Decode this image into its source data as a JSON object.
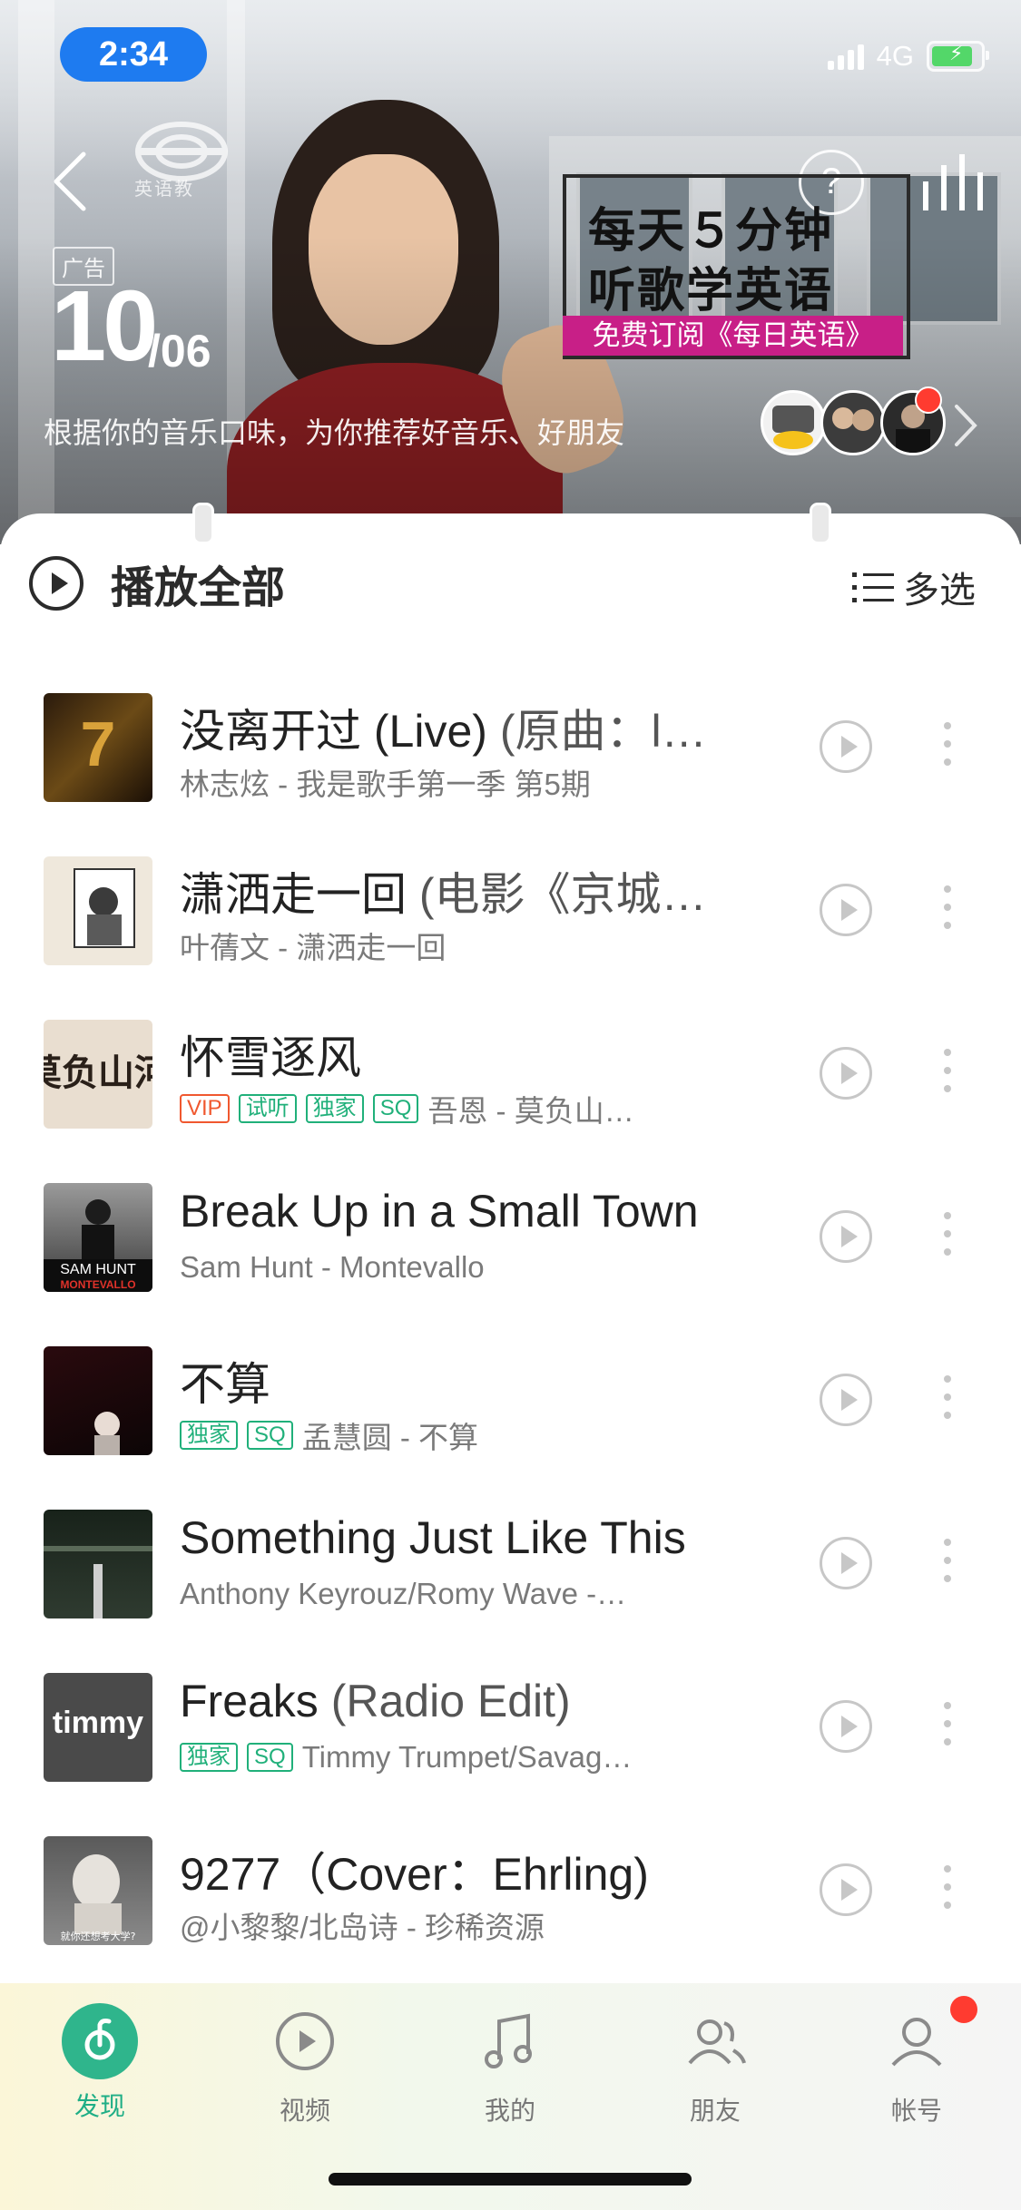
{
  "status": {
    "time": "2:34",
    "network": "4G"
  },
  "hero": {
    "ad_tag": "广告",
    "date_day": "10",
    "date_month": "/06",
    "subtitle": "根据你的音乐口味，为你推荐好音乐、好朋友",
    "promo_line1": "每天５分钟",
    "promo_line2": "听歌学英语",
    "promo_subscribe": "免费订阅《每日英语》",
    "help_label": "?",
    "logo_text": "英语教"
  },
  "list_header": {
    "play_all": "播放全部",
    "multi_select": "多选"
  },
  "songs": [
    {
      "title": "没离开过 (Live)",
      "title_suffix": "(原曲：l…",
      "subtitle": "林志炫 - 我是歌手第一季 第5期",
      "tags": []
    },
    {
      "title": "潇洒走一回",
      "title_suffix": "(电影《京城…",
      "subtitle": "叶蒨文 - 潇洒走一回",
      "tags": []
    },
    {
      "title": "怀雪逐风",
      "title_suffix": "",
      "subtitle": "吾恩 - 莫负山…",
      "tags": [
        "VIP",
        "试听",
        "独家",
        "SQ"
      ]
    },
    {
      "title": "Break Up in a Small Town",
      "title_suffix": "",
      "subtitle": "Sam Hunt - Montevallo",
      "tags": []
    },
    {
      "title": "不算",
      "title_suffix": "",
      "subtitle": "孟慧圆 - 不算",
      "tags": [
        "独家",
        "SQ"
      ]
    },
    {
      "title": "Something Just Like This",
      "title_suffix": "",
      "subtitle": "Anthony Keyrouz/Romy Wave -…",
      "tags": []
    },
    {
      "title": "Freaks",
      "title_suffix": "(Radio Edit)",
      "subtitle": "Timmy Trumpet/Savag…",
      "tags": [
        "独家",
        "SQ"
      ]
    },
    {
      "title": "9277（Cover：Ehrling)",
      "title_suffix": "",
      "subtitle": "@小黎黎/北岛诗 - 珍稀资源",
      "tags": []
    }
  ],
  "covers": {
    "c3_text": "莫负山河",
    "c4_text1": "SAM HUNT",
    "c4_text2": "MONTEVALLO",
    "c7_text": "timmy",
    "c8_text": "就你还想考大学?"
  },
  "tabs": [
    {
      "label": "发现",
      "icon": "discover-icon"
    },
    {
      "label": "视频",
      "icon": "video-icon"
    },
    {
      "label": "我的",
      "icon": "music-note-icon"
    },
    {
      "label": "朋友",
      "icon": "friends-icon"
    },
    {
      "label": "帐号",
      "icon": "account-icon"
    }
  ],
  "colors": {
    "accent": "#2fb58c",
    "promo": "#c81f87",
    "vip": "#f0582f",
    "tag_green": "#20b07a",
    "badge": "#ff3b30"
  }
}
